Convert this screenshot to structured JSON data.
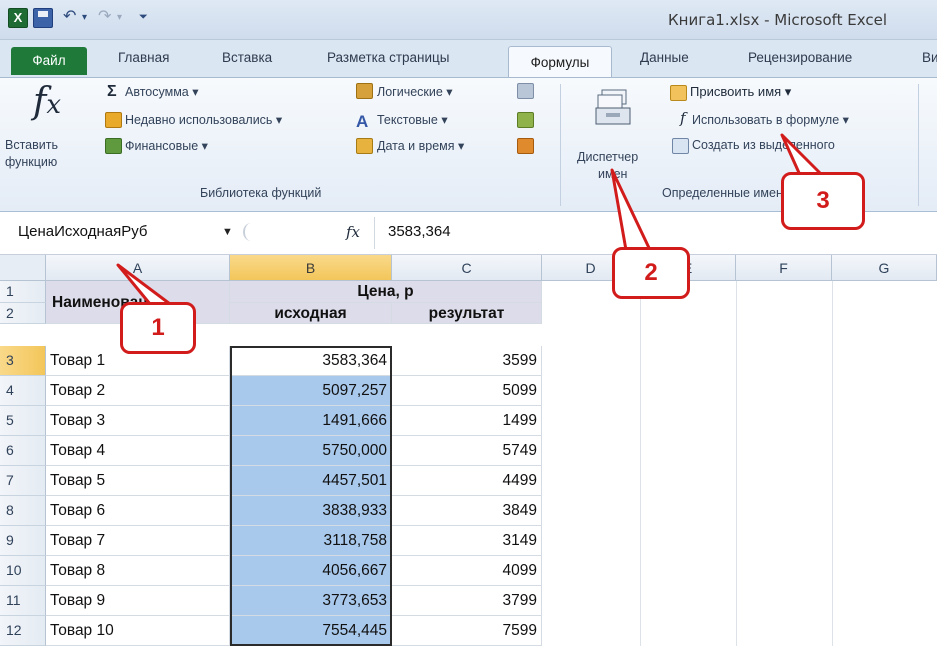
{
  "window": {
    "title": "Книга1.xlsx - Microsoft Excel",
    "app_icon": "excel-icon",
    "qat": {
      "undo": "↶",
      "undo_caret": "▾",
      "redo": "↷",
      "redo_caret": "▾",
      "customize": "⏷"
    }
  },
  "tabs": {
    "file": "Файл",
    "items": [
      "Главная",
      "Вставка",
      "Разметка страницы",
      "Формулы",
      "Данные",
      "Рецензирование",
      "Ви"
    ],
    "active": "Формулы"
  },
  "ribbon": {
    "insert_function": {
      "line1": "Вставить",
      "line2": "функцию"
    },
    "library": {
      "autosum": "Автосумма ▾",
      "recent": "Недавно использовались ▾",
      "financial": "Финансовые ▾",
      "logical": "Логические ▾",
      "text": "Текстовые ▾",
      "datetime": "Дата и время ▾",
      "group_label": "Библиотека функций"
    },
    "names": {
      "manager_line1": "Диспетчер",
      "manager_line2": "имен",
      "define_name": "Присвоить имя ▾",
      "use_in_formula": "Использовать в формуле ▾",
      "create_from_selection": "Создать из выделенного",
      "group_label": "Определенные имена"
    }
  },
  "formula_bar": {
    "name_box": "ЦенаИсходнаяРуб",
    "fx": "fx",
    "value": "3583,364"
  },
  "sheet": {
    "columns": [
      "A",
      "B",
      "C",
      "D",
      "E",
      "F",
      "G"
    ],
    "header": {
      "a": "Наименование",
      "price": "Цена, р",
      "original": "исходная",
      "result": "результат"
    },
    "rows": [
      {
        "n": "3",
        "name": "Товар 1",
        "orig": "3583,364",
        "res": "3599"
      },
      {
        "n": "4",
        "name": "Товар 2",
        "orig": "5097,257",
        "res": "5099"
      },
      {
        "n": "5",
        "name": "Товар 3",
        "orig": "1491,666",
        "res": "1499"
      },
      {
        "n": "6",
        "name": "Товар 4",
        "orig": "5750,000",
        "res": "5749"
      },
      {
        "n": "7",
        "name": "Товар 5",
        "orig": "4457,501",
        "res": "4499"
      },
      {
        "n": "8",
        "name": "Товар 6",
        "orig": "3838,933",
        "res": "3849"
      },
      {
        "n": "9",
        "name": "Товар 7",
        "orig": "3118,758",
        "res": "3149"
      },
      {
        "n": "10",
        "name": "Товар 8",
        "orig": "4056,667",
        "res": "4099"
      },
      {
        "n": "11",
        "name": "Товар 9",
        "orig": "3773,653",
        "res": "3799"
      },
      {
        "n": "12",
        "name": "Товар 10",
        "orig": "7554,445",
        "res": "7599"
      }
    ],
    "row1": "1",
    "row2": "2"
  },
  "callouts": [
    "1",
    "2",
    "3"
  ],
  "colors": {
    "accent_red": "#d21c1c",
    "selection": "#a9c9ec",
    "file_tab": "#1f7a3a"
  }
}
